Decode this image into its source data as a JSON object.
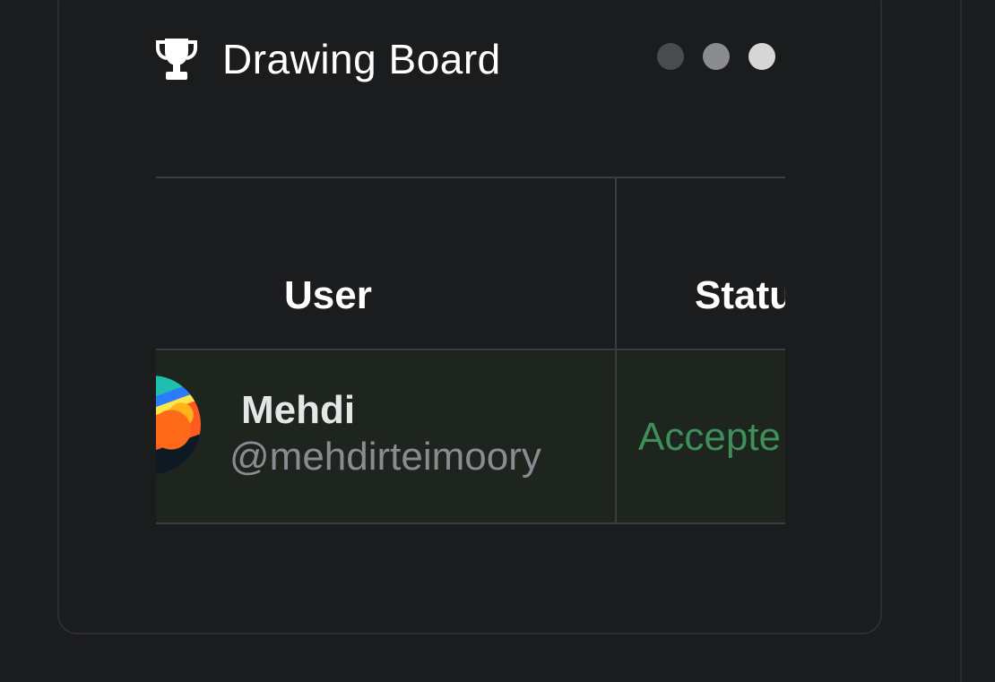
{
  "board": {
    "title": "Drawing Board",
    "icon": "trophy-icon"
  },
  "window_controls": {
    "dots": [
      {
        "name": "dot-1",
        "color": "#4a4b4e"
      },
      {
        "name": "dot-2",
        "color": "#8b8c8f"
      },
      {
        "name": "dot-3",
        "color": "#d6d6d6"
      }
    ]
  },
  "table": {
    "columns": [
      "User",
      "Statu"
    ],
    "rows": [
      {
        "name": "Mehdi",
        "handle": "@mehdirteimoory",
        "status": "Accepte"
      }
    ]
  },
  "colors": {
    "background": "#1b1c1e",
    "row_highlight": "#1d251e",
    "status_accepted": "#3f8f5a"
  }
}
